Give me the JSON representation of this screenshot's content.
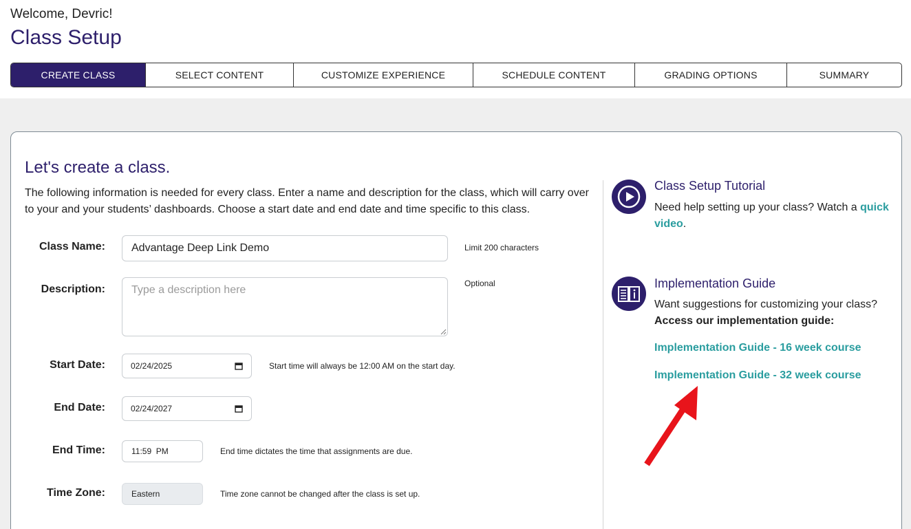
{
  "header": {
    "welcome": "Welcome, Devric!",
    "title": "Class Setup"
  },
  "steps": [
    {
      "label": "CREATE CLASS",
      "active": true
    },
    {
      "label": "SELECT CONTENT",
      "active": false
    },
    {
      "label": "CUSTOMIZE EXPERIENCE",
      "active": false
    },
    {
      "label": "SCHEDULE CONTENT",
      "active": false
    },
    {
      "label": "GRADING OPTIONS",
      "active": false
    },
    {
      "label": "SUMMARY",
      "active": false
    }
  ],
  "form": {
    "heading": "Let's create a class.",
    "intro": "The following information is needed for every class. Enter a name and description for the class, which will carry over to your and your students’ dashboards. Choose a start date and end date and time specific to this class.",
    "class_name": {
      "label": "Class Name:",
      "value": "Advantage Deep Link Demo",
      "hint": "Limit 200 characters"
    },
    "description": {
      "label": "Description:",
      "placeholder": "Type a description here",
      "hint": "Optional"
    },
    "start_date": {
      "label": "Start Date:",
      "value": "02/24/2025",
      "hint": "Start time will always be 12:00 AM on the start day."
    },
    "end_date": {
      "label": "End Date:",
      "value": "02/24/2027"
    },
    "end_time": {
      "label": "End Time:",
      "value": "11:59  PM",
      "hint": "End time dictates the time that assignments are due."
    },
    "time_zone": {
      "label": "Time Zone:",
      "value": "Eastern",
      "hint": "Time zone cannot be changed after the class is set up."
    }
  },
  "sidebar": {
    "tutorial": {
      "icon": "play-circle-icon",
      "title": "Class Setup Tutorial",
      "text": "Need help setting up your class? Watch a ",
      "link": "quick video",
      "after": "."
    },
    "guide": {
      "icon": "open-book-icon",
      "title": "Implementation Guide",
      "text": "Want suggestions for customizing your class?",
      "bold": "Access our implementation guide:",
      "links": [
        "Implementation Guide - 16 week course",
        "Implementation Guide - 32 week course"
      ]
    }
  },
  "annotation": {
    "icon": "red-arrow-icon",
    "color": "#e8141b"
  },
  "colors": {
    "brand": "#2d1f6b",
    "link": "#2a9d9f"
  }
}
